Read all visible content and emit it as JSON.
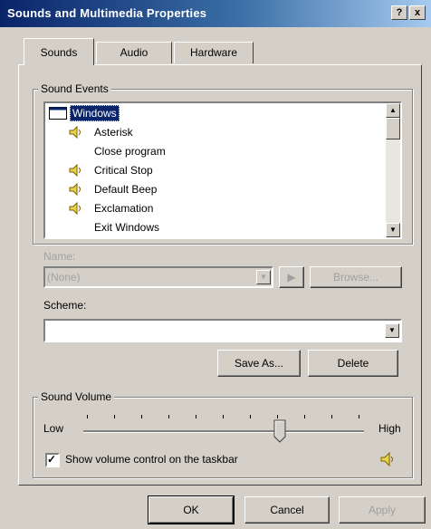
{
  "window": {
    "title": "Sounds and Multimedia Properties",
    "help": "?",
    "close": "x"
  },
  "tabs": [
    {
      "label": "Sounds"
    },
    {
      "label": "Audio"
    },
    {
      "label": "Hardware"
    }
  ],
  "sound_events": {
    "legend": "Sound Events",
    "items": [
      {
        "label": "Windows",
        "icon": "folder-icon",
        "selected": true
      },
      {
        "label": "Asterisk",
        "icon": "speaker-icon"
      },
      {
        "label": "Close program",
        "icon": ""
      },
      {
        "label": "Critical Stop",
        "icon": "speaker-icon"
      },
      {
        "label": "Default Beep",
        "icon": "speaker-icon"
      },
      {
        "label": "Exclamation",
        "icon": "speaker-icon"
      },
      {
        "label": "Exit Windows",
        "icon": ""
      }
    ]
  },
  "name": {
    "label": "Name:",
    "value": "(None)",
    "browse": "Browse..."
  },
  "scheme": {
    "label": "Scheme:",
    "value": "",
    "save_as": "Save As...",
    "delete": "Delete"
  },
  "volume": {
    "legend": "Sound Volume",
    "low": "Low",
    "high": "High",
    "level": 0.7,
    "show_icon_label": "Show volume control on the taskbar",
    "show_icon_checked": true
  },
  "footer": {
    "ok": "OK",
    "cancel": "Cancel",
    "apply": "Apply"
  },
  "colors": {
    "title_start": "#0a246a",
    "title_end": "#a6caf0",
    "selection": "#0a246a",
    "face": "#d4d0c8"
  }
}
